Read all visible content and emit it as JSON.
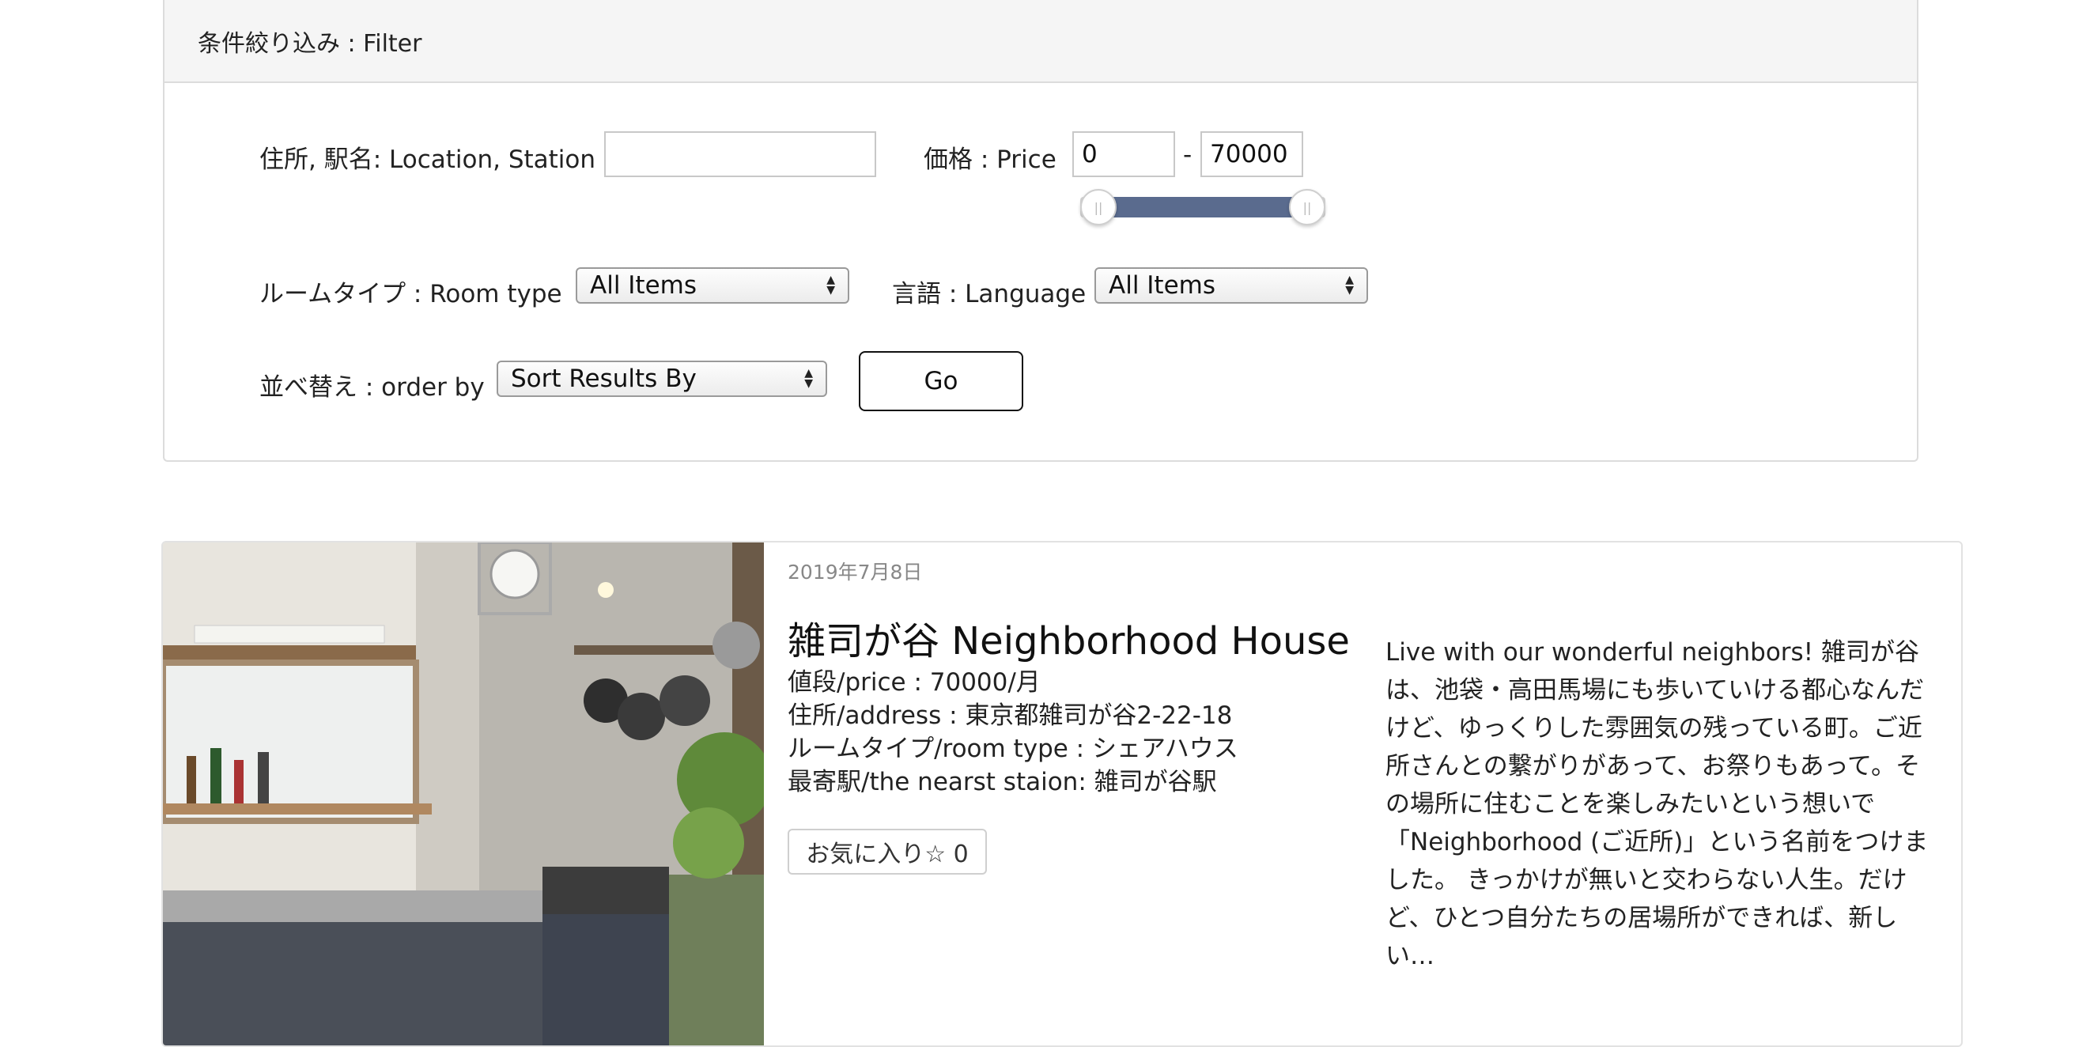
{
  "filter": {
    "header": "条件絞り込み : Filter",
    "location_label": "住所, 駅名: Location, Station",
    "location_value": "",
    "price_label": "価格 : Price",
    "price_min": "0",
    "price_sep": "-",
    "price_max": "70000",
    "price_range_fraction": [
      0.0,
      1.0
    ],
    "room_type_label": "ルームタイプ : Room type",
    "room_type_value": "All Items",
    "language_label": "言語 : Language",
    "language_value": "All Items",
    "order_label": "並べ替え : order by",
    "order_value": "Sort Results By",
    "go_label": "Go"
  },
  "listing": {
    "date": "2019年7月8日",
    "title": "雑司が谷 Neighborhood House",
    "price": "値段/price : 70000/月",
    "address": "住所/address : 東京都雑司が谷2-22-18",
    "room_type": "ルームタイプ/room type : シェアハウス",
    "station": "最寄駅/the nearst staion: 雑司が谷駅",
    "favorite": "お気に入り☆ 0",
    "description": " Live with our wonderful neighbors! 雑司が谷は、池袋・高田馬場にも歩いていける都心なんだけど、ゆっくりした雰囲気の残っている町。ご近所さんとの繋がりがあって、お祭りもあって。その場所に住むことを楽しみたいという想いで「Neighborhood (ご近所)」という名前をつけました。 きっかけが無いと交わらない人生。だけど、ひとつ自分たちの居場所ができれば、新しい…"
  }
}
